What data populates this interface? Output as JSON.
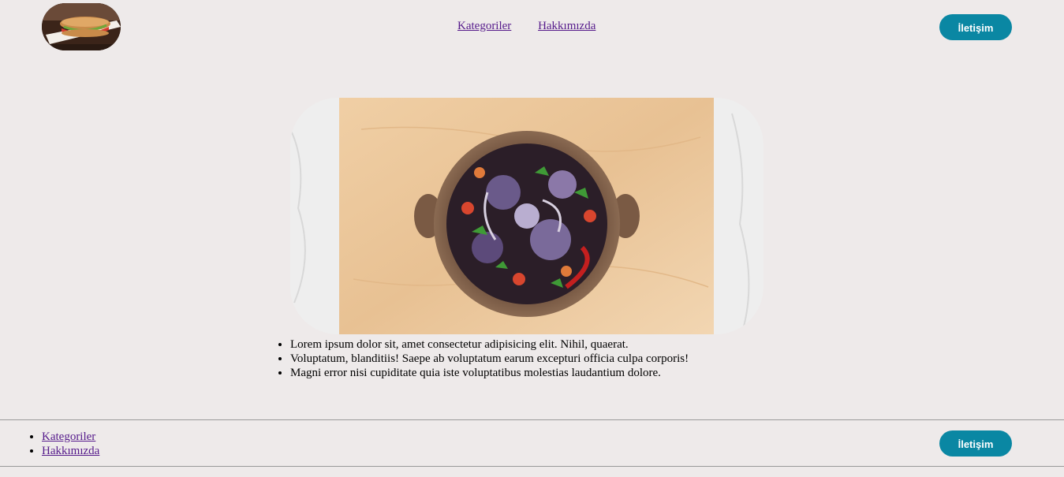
{
  "header": {
    "logo_alt": "sandwich-logo",
    "nav": [
      {
        "label": "Kategoriler"
      },
      {
        "label": "Hakkımızda"
      }
    ],
    "contact_button": "İletişim"
  },
  "hero": {
    "image": "salad-bowl-photo"
  },
  "content": {
    "items": [
      "Lorem ipsum dolor sit, amet consectetur adipisicing elit. Nihil, quaerat.",
      "Voluptatum, blanditiis! Saepe ab voluptatum earum excepturi officia culpa corporis!",
      "Magni error nisi cupiditate quia iste voluptatibus molestias laudantium dolore."
    ]
  },
  "footer": {
    "nav": [
      {
        "label": "Kategoriler"
      },
      {
        "label": "Hakkımızda"
      }
    ],
    "contact_button": "İletişim"
  },
  "colors": {
    "background": "#eeeaea",
    "accent": "#0a87a3",
    "link": "#551a8b"
  }
}
